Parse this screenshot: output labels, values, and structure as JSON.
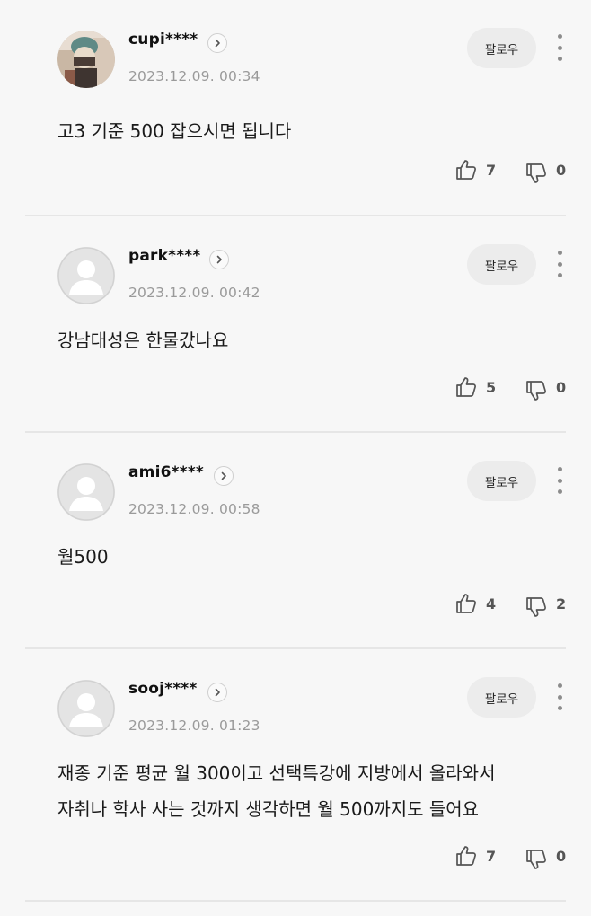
{
  "comments": [
    {
      "username": "cupi****",
      "date": "2023.12.09. 00:34",
      "follow_label": "팔로우",
      "text": "고3 기준 500 잡으시면 됩니다",
      "likes": "7",
      "dislikes": "0",
      "avatar": "photo-avatar"
    },
    {
      "username": "park****",
      "date": "2023.12.09. 00:42",
      "follow_label": "팔로우",
      "text": "강남대성은 한물갔나요",
      "likes": "5",
      "dislikes": "0",
      "avatar": "default-avatar"
    },
    {
      "username": "ami6****",
      "date": "2023.12.09. 00:58",
      "follow_label": "팔로우",
      "text": "월500",
      "likes": "4",
      "dislikes": "2",
      "avatar": "default-avatar"
    },
    {
      "username": "sooj****",
      "date": "2023.12.09. 01:23",
      "follow_label": "팔로우",
      "text_lines": [
        "재종 기준 평균 월 300이고 선택특강에 지방에서 올라와서",
        "자취나 학사 사는 것까지 생각하면 월 500까지도 들어요"
      ],
      "likes": "7",
      "dislikes": "0",
      "avatar": "default-avatar"
    }
  ],
  "icons": {
    "thumbs_up": "thumbs-up-icon",
    "thumbs_down": "thumbs-down-icon",
    "more": "more-vertical-icon",
    "arrow": "chevron-right-icon"
  },
  "colors": {
    "background": "#f7f7f7",
    "follow_button": "#ececec",
    "date": "#9a9a9a",
    "divider": "#e6e6e6"
  }
}
